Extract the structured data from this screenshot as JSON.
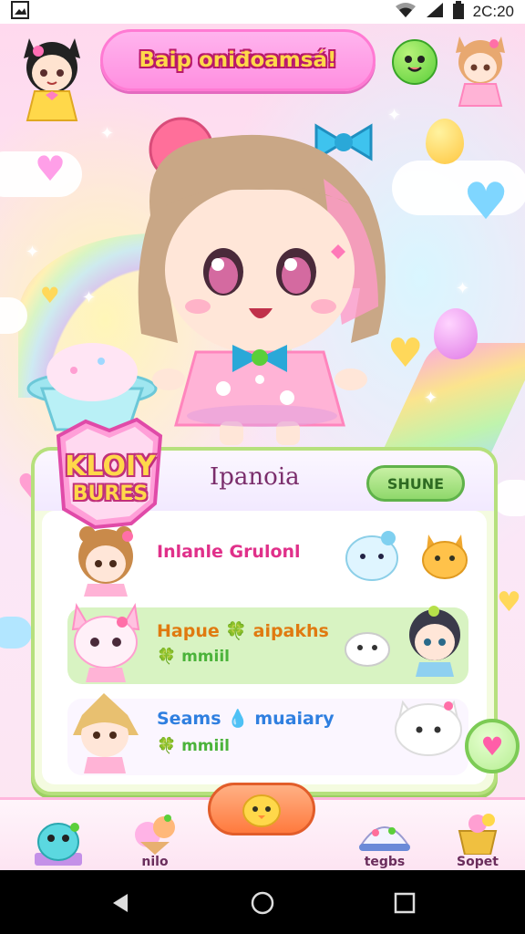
{
  "status_bar": {
    "time": "2C:20",
    "icons": [
      "image-notification-icon",
      "wifi-icon",
      "signal-icon",
      "battery-icon"
    ]
  },
  "header": {
    "title": "Baip oniđoamsá!",
    "left_avatar": "avatar-cat-girl",
    "right_avatar": "avatar-fox-girl",
    "green_button": "green-smiley-icon"
  },
  "panel": {
    "logo_line1": "KLOIY",
    "logo_line2": "BURES",
    "title": "Ipanoia",
    "share_label": "SHUNE",
    "rows": [
      {
        "line1": "Inlanle Grulonl",
        "line1_color": "#e0308a",
        "line2": "",
        "avatar": "bear-girl-avatar",
        "icons": [
          "blue-cat-icon",
          "yellow-fox-icon"
        ],
        "bg": "#ffffff"
      },
      {
        "line1": "Hapue 🍀 aipakhs",
        "line1_color": "#e07a10",
        "line2": "🍀 mmiil",
        "avatar": "pink-cat-avatar",
        "icons": [
          "white-blob-icon",
          "dark-hair-boy-icon"
        ],
        "bg": "#d8f3c2"
      },
      {
        "line1": "Seams 💧 muaiary",
        "line1_color": "#2f7fe0",
        "line2": "🍀 mmiil",
        "avatar": "blonde-boy-avatar",
        "icons": [
          "white-cat-icon"
        ],
        "bg": "#fbf6ff"
      }
    ]
  },
  "bottom_nav": [
    {
      "label": "",
      "icon": "blue-monster-icon"
    },
    {
      "label": "nilo",
      "icon": "ice-cream-icon"
    },
    {
      "label": "",
      "icon": "yellow-chick-icon"
    },
    {
      "label": "tegbs",
      "icon": "cake-dome-icon"
    },
    {
      "label": "Sopet",
      "icon": "gift-basket-icon"
    }
  ],
  "colors": {
    "title_pill": "#ff8fe0",
    "panel_border": "#b6e07d",
    "accent_pink": "#ff5ea8"
  }
}
